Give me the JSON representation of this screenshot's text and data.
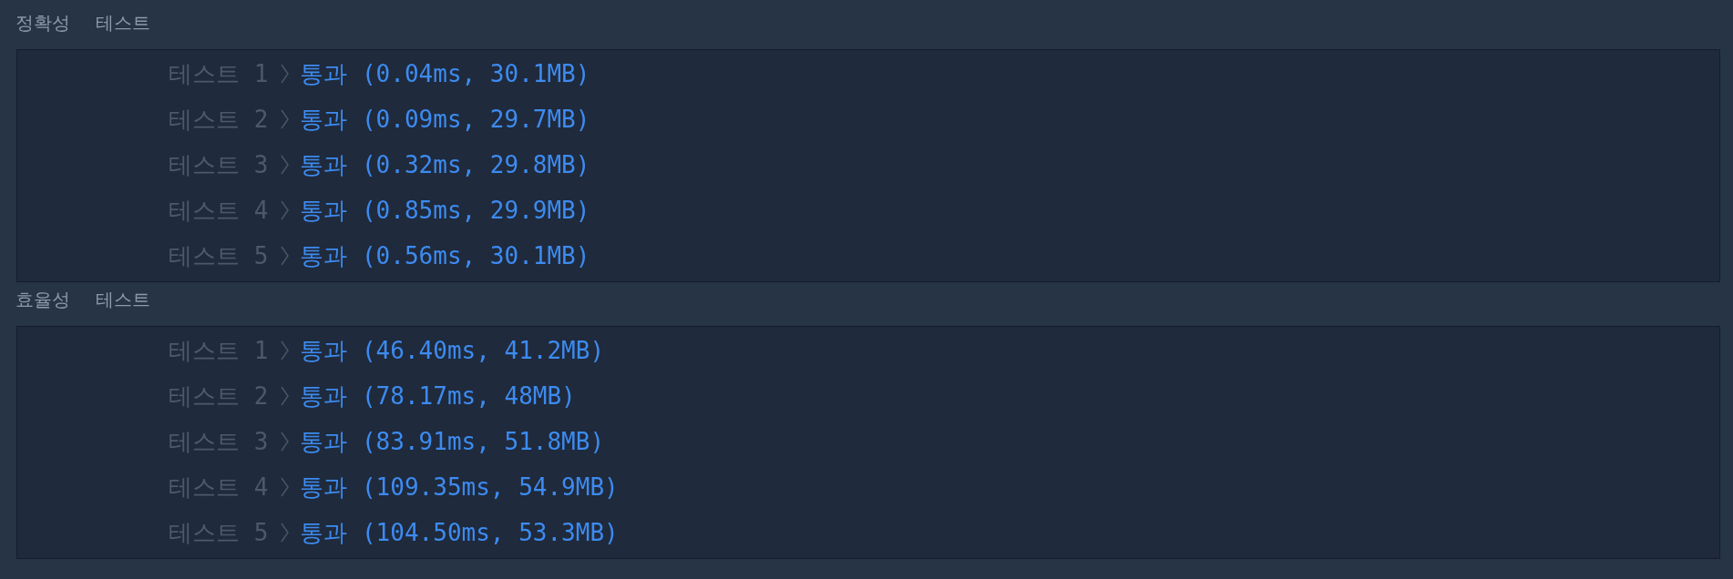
{
  "sections": [
    {
      "title": "정확성 테스트",
      "tests": [
        {
          "label": "테스트 1",
          "result": "통과 (0.04ms, 30.1MB)"
        },
        {
          "label": "테스트 2",
          "result": "통과 (0.09ms, 29.7MB)"
        },
        {
          "label": "테스트 3",
          "result": "통과 (0.32ms, 29.8MB)"
        },
        {
          "label": "테스트 4",
          "result": "통과 (0.85ms, 29.9MB)"
        },
        {
          "label": "테스트 5",
          "result": "통과 (0.56ms, 30.1MB)"
        }
      ]
    },
    {
      "title": "효율성 테스트",
      "tests": [
        {
          "label": "테스트 1",
          "result": "통과 (46.40ms, 41.2MB)"
        },
        {
          "label": "테스트 2",
          "result": "통과 (78.17ms, 48MB)"
        },
        {
          "label": "테스트 3",
          "result": "통과 (83.91ms, 51.8MB)"
        },
        {
          "label": "테스트 4",
          "result": "통과 (109.35ms, 54.9MB)"
        },
        {
          "label": "테스트 5",
          "result": "통과 (104.50ms, 53.3MB)"
        }
      ]
    }
  ]
}
